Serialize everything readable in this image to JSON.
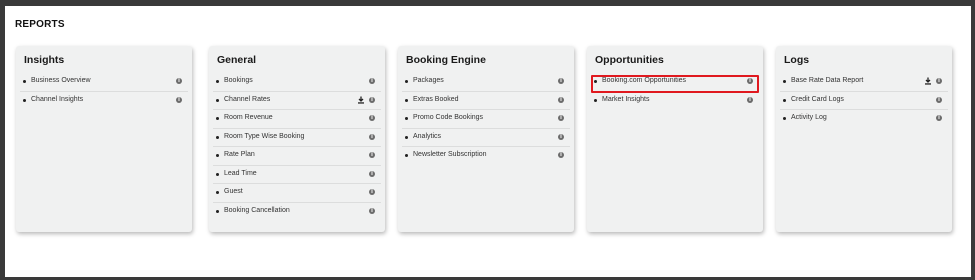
{
  "page": {
    "title": "REPORTS"
  },
  "cards": [
    {
      "title": "Insights",
      "items": [
        {
          "label": "Business Overview",
          "download": false
        },
        {
          "label": "Channel Insights",
          "download": false
        }
      ]
    },
    {
      "title": "General",
      "items": [
        {
          "label": "Bookings",
          "download": false
        },
        {
          "label": "Channel Rates",
          "download": true
        },
        {
          "label": "Room Revenue",
          "download": false
        },
        {
          "label": "Room Type Wise Booking",
          "download": false
        },
        {
          "label": "Rate Plan",
          "download": false
        },
        {
          "label": "Lead Time",
          "download": false
        },
        {
          "label": "Guest",
          "download": false
        },
        {
          "label": "Booking Cancellation",
          "download": false
        }
      ]
    },
    {
      "title": "Booking Engine",
      "items": [
        {
          "label": "Packages",
          "download": false
        },
        {
          "label": "Extras Booked",
          "download": false
        },
        {
          "label": "Promo Code Bookings",
          "download": false
        },
        {
          "label": "Analytics",
          "download": false
        },
        {
          "label": "Newsletter Subscription",
          "download": false
        }
      ]
    },
    {
      "title": "Opportunities",
      "items": [
        {
          "label": "Booking.com Opportunities",
          "download": false,
          "highlighted": true
        },
        {
          "label": "Market Insights",
          "download": false
        }
      ]
    },
    {
      "title": "Logs",
      "items": [
        {
          "label": "Base Rate Data Report",
          "download": true
        },
        {
          "label": "Credit Card Logs",
          "download": false
        },
        {
          "label": "Activity Log",
          "download": false
        }
      ]
    }
  ],
  "icons": {
    "info": "info-icon",
    "download": "download-icon"
  },
  "colors": {
    "highlight": "#e0191f",
    "card_bg": "#f0f1f1",
    "page_bg": "#ffffff"
  }
}
